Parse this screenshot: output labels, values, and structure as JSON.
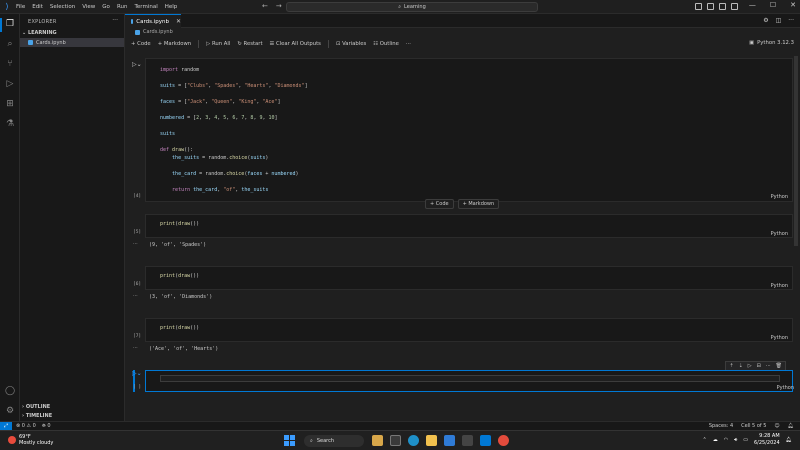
{
  "window": {
    "menu": [
      "File",
      "Edit",
      "Selection",
      "View",
      "Go",
      "Run",
      "Terminal",
      "Help"
    ],
    "search_text": "Learning"
  },
  "sidebar": {
    "title": "EXPLORER",
    "section": "LEARNING",
    "file": "Cards.ipynb",
    "outline": "OUTLINE",
    "timeline": "TIMELINE"
  },
  "tab": {
    "label": "Cards.ipynb"
  },
  "breadcrumb": "Cards.ipynb",
  "toolbar": {
    "code": "Code",
    "markdown": "Markdown",
    "run_all": "Run All",
    "restart": "Restart",
    "clear_outputs": "Clear All Outputs",
    "variables": "Variables",
    "outline": "Outline",
    "kernel": "Python 3.12.3"
  },
  "cells": [
    {
      "exec": "[4]",
      "lines": [
        "import random",
        "suits = [\"Clubs\", \"Spades\", \"Hearts\", \"Diamonds\"]",
        "faces = [\"Jack\", \"Queen\", \"King\", \"Ace\"]",
        "numbered = [2, 3, 4, 5, 6, 7, 8, 9, 10]",
        "suits",
        "def draw():",
        "    the_suits = random.choice(suits)",
        "    the_card = random.choice(faces + numbered)",
        "    return the_card, \"of\", the_suits"
      ],
      "lang": "Python"
    },
    {
      "exec": "[5]",
      "code": "print(draw())",
      "output": "(9, 'of', 'Spades')",
      "lang": "Python"
    },
    {
      "exec": "[6]",
      "code": "print(draw())",
      "output": "(3, 'of', 'Diamonds')",
      "lang": "Python"
    },
    {
      "exec": "[7]",
      "code": "print(draw())",
      "output": "('Ace', 'of', 'Hearts')",
      "lang": "Python"
    },
    {
      "exec": "[ ]",
      "code": "",
      "lang": "Python"
    }
  ],
  "add_cell": {
    "code": "+ Code",
    "markdown": "+ Markdown"
  },
  "status": {
    "errors": "⊗ 0 ⚠ 0",
    "ports": "⛯ 0",
    "spaces": "Spaces: 4",
    "cell": "Cell 5 of 5"
  },
  "taskbar": {
    "temp": "69°F",
    "weather": "Mostly cloudy",
    "search": "Search",
    "time": "9:28 AM",
    "date": "6/25/2024"
  },
  "colors": {
    "accent": "#0078d4",
    "keyword": "#c586c0",
    "string": "#ce9178",
    "number": "#b5cea8",
    "function": "#dcdcaa"
  }
}
